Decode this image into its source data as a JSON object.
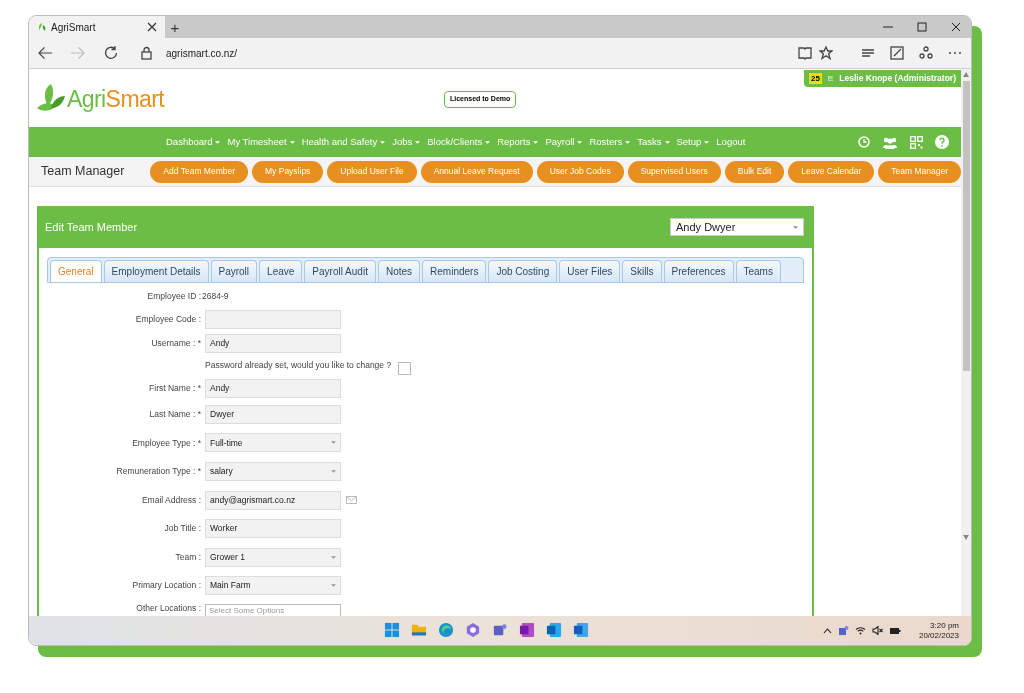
{
  "browser": {
    "tab_title": "AgriSmart",
    "new_tab": "+",
    "url": "agrismart.co.nz/"
  },
  "header": {
    "logo": {
      "first": "Agri",
      "second": "Smart"
    },
    "license_badge": "Licensed to Demo",
    "user_count": "25",
    "user_name": "Leslie Knope (Administrator)"
  },
  "nav": [
    {
      "label": "Dashboard",
      "dropdown": true
    },
    {
      "label": "My Timesheet",
      "dropdown": true
    },
    {
      "label": "Health and Safety",
      "dropdown": true
    },
    {
      "label": "Jobs",
      "dropdown": true
    },
    {
      "label": "Block/Clients",
      "dropdown": true
    },
    {
      "label": "Reports",
      "dropdown": true
    },
    {
      "label": "Payroll",
      "dropdown": true
    },
    {
      "label": "Rosters",
      "dropdown": true
    },
    {
      "label": "Tasks",
      "dropdown": true
    },
    {
      "label": "Setup",
      "dropdown": true
    },
    {
      "label": "Logout",
      "dropdown": false
    }
  ],
  "subbar": {
    "title": "Team Manager",
    "buttons": [
      "Add Team Member",
      "My Payslips",
      "Upload User File",
      "Annual Leave Request",
      "User Job Codes",
      "Supervised Users",
      "Bulk Edit",
      "Leave Calendar",
      "Team Manager"
    ]
  },
  "panel": {
    "title": "Edit Team Member",
    "member_select": "Andy Dwyer",
    "tabs": [
      {
        "label": "General",
        "selected": true
      },
      {
        "label": "Employment Details",
        "selected": false
      },
      {
        "label": "Payroll",
        "selected": false
      },
      {
        "label": "Leave",
        "selected": false
      },
      {
        "label": "Payroll Audit",
        "selected": false
      },
      {
        "label": "Notes",
        "selected": false
      },
      {
        "label": "Reminders",
        "selected": false
      },
      {
        "label": "Job Costing",
        "selected": false
      },
      {
        "label": "User Files",
        "selected": false
      },
      {
        "label": "Skills",
        "selected": false
      },
      {
        "label": "Preferences",
        "selected": false
      },
      {
        "label": "Teams",
        "selected": false
      }
    ],
    "fields": [
      {
        "kind": "static",
        "label": "Employee ID :",
        "value": "2684-9"
      },
      {
        "kind": "text",
        "label": "Employee Code :"
      },
      {
        "kind": "text",
        "label": "Username : *",
        "value": "Andy"
      },
      {
        "kind": "checkbox",
        "label": "Password already set, would you like to change ?",
        "checked": false
      },
      {
        "kind": "text",
        "label": "First Name : *",
        "value": "Andy"
      },
      {
        "kind": "text",
        "label": "Last Name : *",
        "value": "Dwyer"
      },
      {
        "kind": "select",
        "label": "Employee Type : *",
        "value": "Full-time"
      },
      {
        "kind": "select",
        "label": "Remuneration Type : *",
        "value": "salary"
      },
      {
        "kind": "email",
        "label": "Email Address :",
        "value": "andy@agrismart.co.nz"
      },
      {
        "kind": "text",
        "label": "Job Title :",
        "value": "Worker"
      },
      {
        "kind": "select",
        "label": "Team :",
        "value": "Grower 1"
      },
      {
        "kind": "select",
        "label": "Primary Location :",
        "value": "Main Farm"
      },
      {
        "kind": "multiselect",
        "label": "Other Locations :",
        "placeholder": "Select Some Options"
      }
    ]
  },
  "taskbar": {
    "time": "3:20 pm",
    "date": "20/02/2023"
  }
}
